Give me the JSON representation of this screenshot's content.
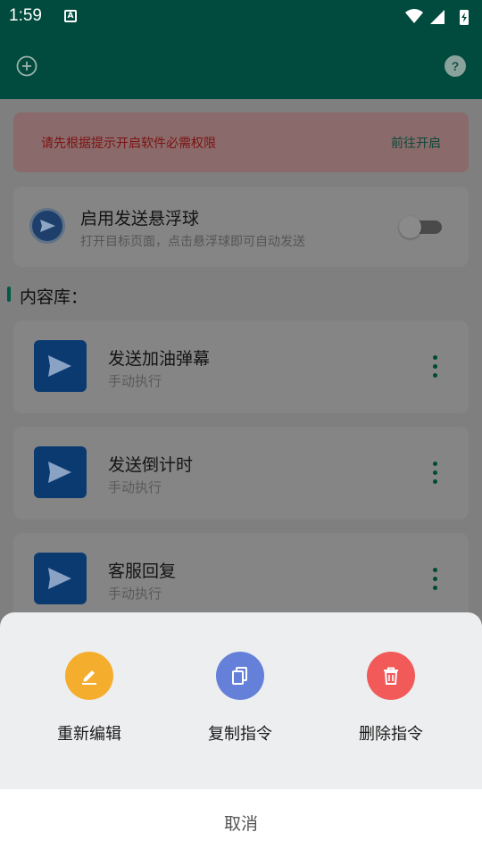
{
  "status_bar": {
    "time": "1:59"
  },
  "banner": {
    "message": "请先根据提示开启软件必需权限",
    "action": "前往开启"
  },
  "float_ball": {
    "title": "启用发送悬浮球",
    "subtitle": "打开目标页面，点击悬浮球即可自动发送",
    "enabled": false
  },
  "library": {
    "heading": "内容库："
  },
  "items": [
    {
      "name": "发送加油弹幕",
      "mode": "手动执行"
    },
    {
      "name": "发送倒计时",
      "mode": "手动执行"
    },
    {
      "name": "客服回复",
      "mode": "手动执行"
    }
  ],
  "sheet": {
    "actions": [
      {
        "label": "重新编辑",
        "icon": "pencil-icon",
        "color": "#f5ad2d"
      },
      {
        "label": "复制指令",
        "icon": "copy-icon",
        "color": "#6580d9"
      },
      {
        "label": "删除指令",
        "icon": "trash-icon",
        "color": "#f25a5a"
      }
    ],
    "cancel": "取消"
  },
  "colors": {
    "primary": "#004b3d",
    "scrim": "#7f7f7f"
  }
}
